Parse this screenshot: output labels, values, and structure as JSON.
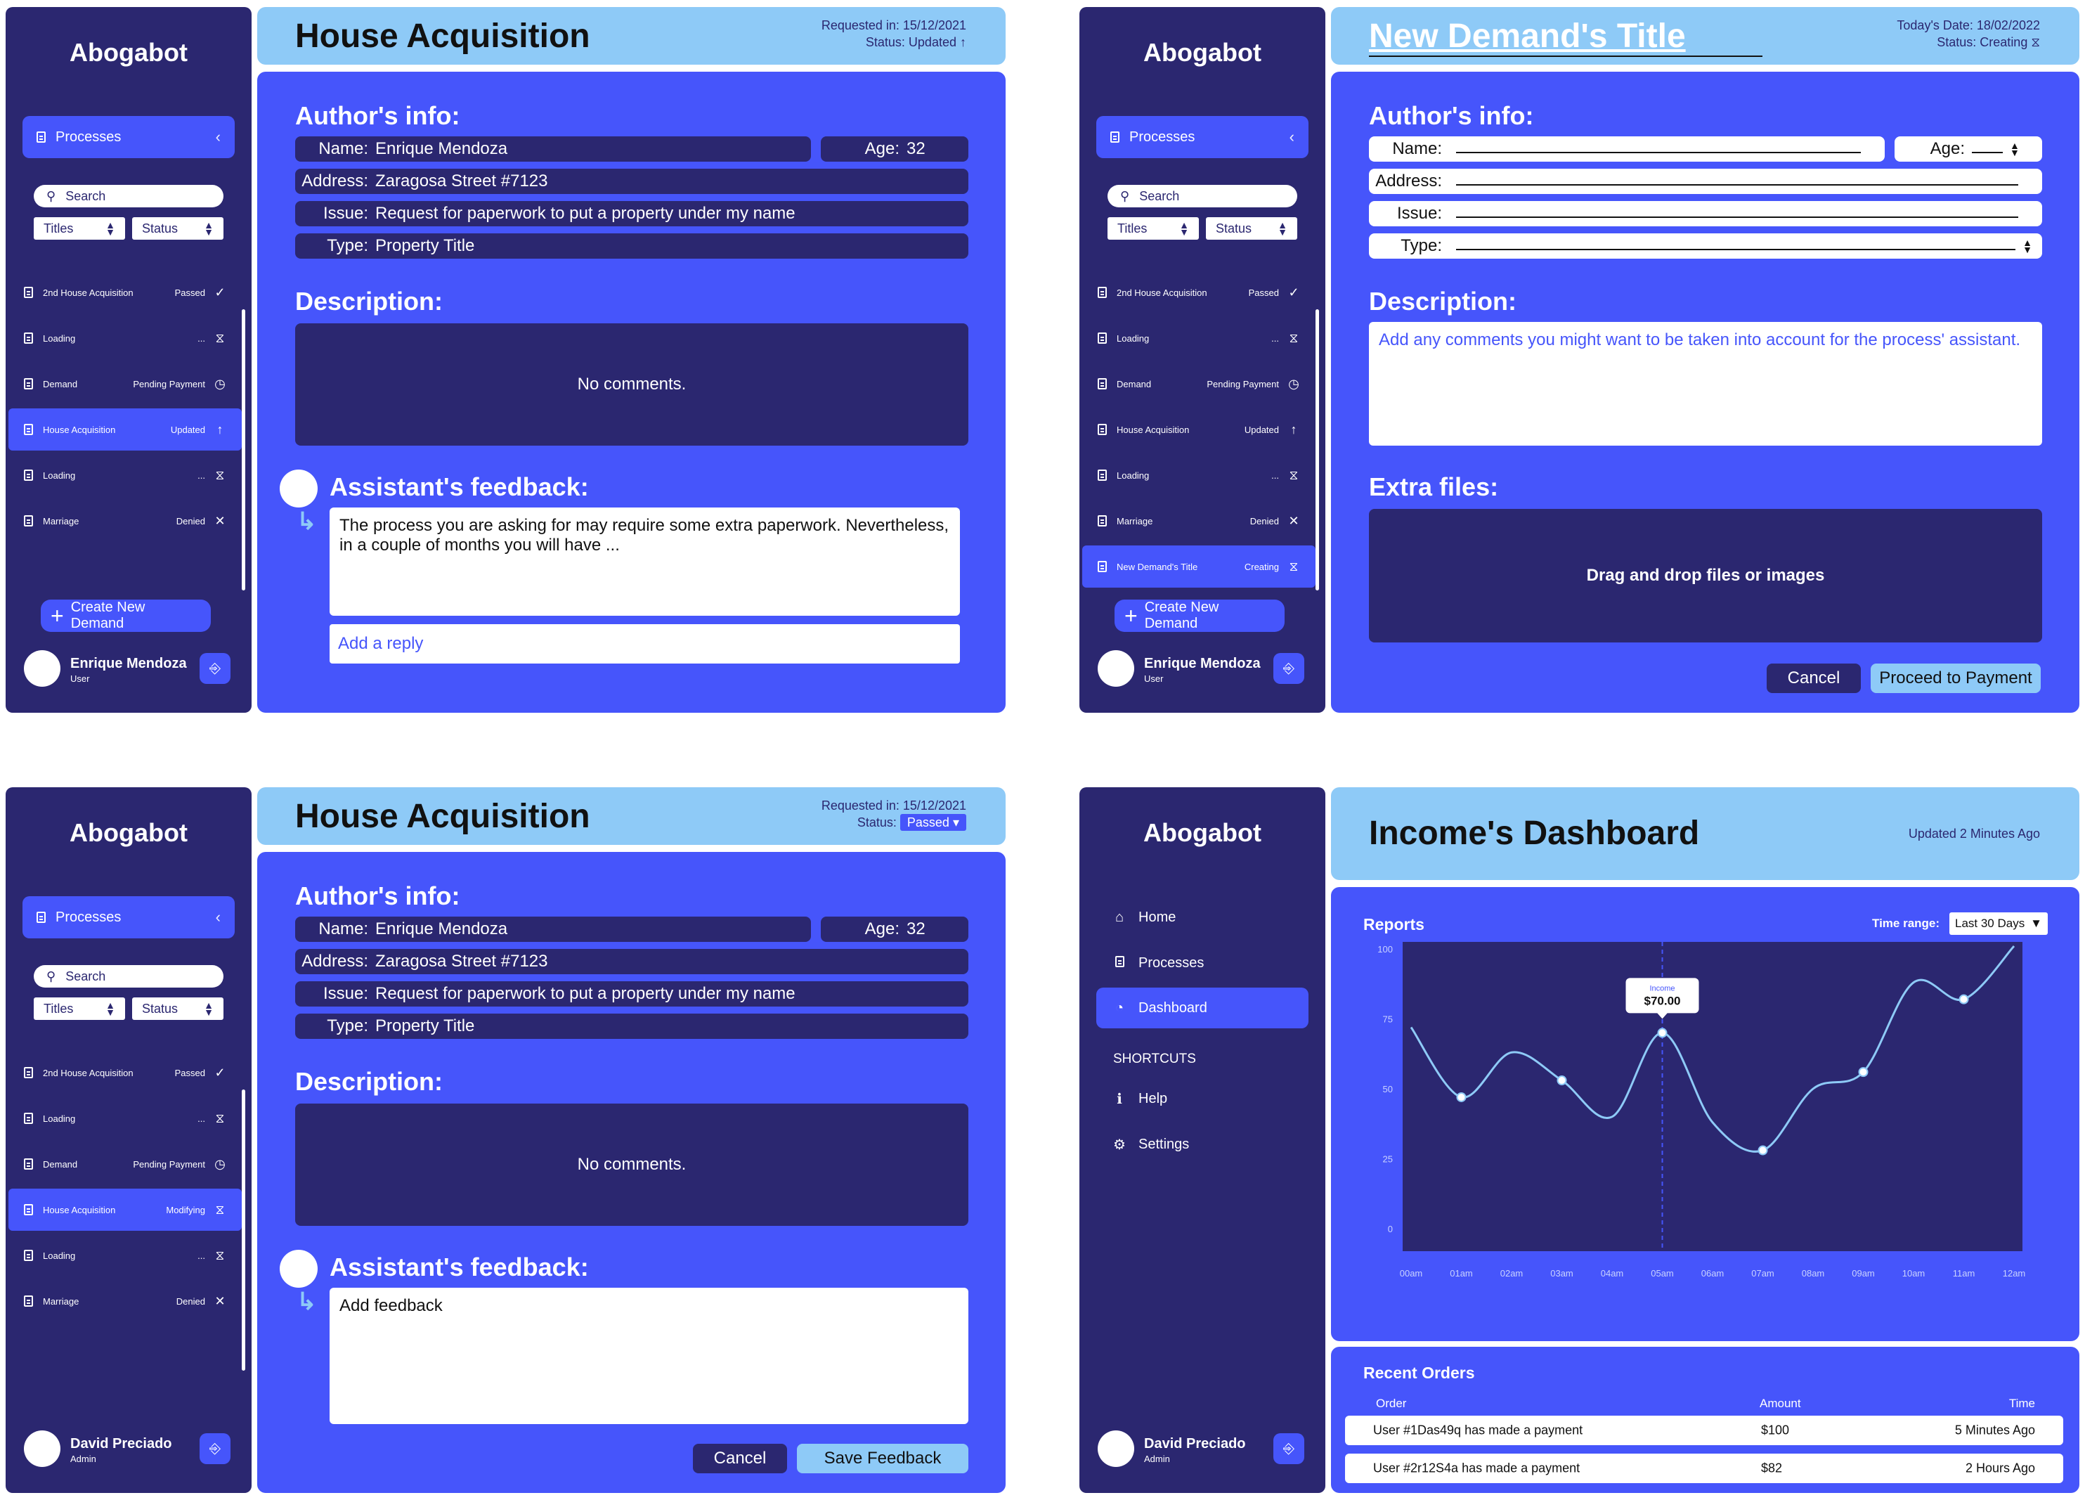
{
  "app_name": "Abogabot",
  "sidebar_common": {
    "processes_label": "Processes",
    "search_placeholder": "Search",
    "titles_filter": "Titles",
    "status_filter": "Status",
    "create_button": "Create New Demand"
  },
  "lists": {
    "p1": [
      {
        "name": "2nd House Acquisition",
        "status": "Passed",
        "icon": "check-icon"
      },
      {
        "name": "Loading",
        "status": "...",
        "icon": "hourglass-icon"
      },
      {
        "name": "Demand",
        "status": "Pending Payment",
        "icon": "clock-icon"
      },
      {
        "name": "House Acquisition",
        "status": "Updated",
        "icon": "arrow-up-icon",
        "active": true
      },
      {
        "name": "Loading",
        "status": "...",
        "icon": "hourglass-icon"
      },
      {
        "name": "Marriage",
        "status": "Denied",
        "icon": "x-icon"
      }
    ],
    "p2": [
      {
        "name": "2nd House Acquisition",
        "status": "Passed",
        "icon": "check-icon"
      },
      {
        "name": "Loading",
        "status": "...",
        "icon": "hourglass-icon"
      },
      {
        "name": "Demand",
        "status": "Pending Payment",
        "icon": "clock-icon"
      },
      {
        "name": "House Acquisition",
        "status": "Updated",
        "icon": "arrow-up-icon"
      },
      {
        "name": "Loading",
        "status": "...",
        "icon": "hourglass-icon"
      },
      {
        "name": "Marriage",
        "status": "Denied",
        "icon": "x-icon"
      },
      {
        "name": "New Demand's Title",
        "status": "Creating",
        "icon": "hourglass-icon",
        "active": true
      }
    ],
    "p3": [
      {
        "name": "2nd House Acquisition",
        "status": "Passed",
        "icon": "check-icon"
      },
      {
        "name": "Loading",
        "status": "...",
        "icon": "hourglass-icon"
      },
      {
        "name": "Demand",
        "status": "Pending Payment",
        "icon": "clock-icon"
      },
      {
        "name": "House Acquisition",
        "status": "Modifying",
        "icon": "hourglass-icon",
        "active": true
      },
      {
        "name": "Loading",
        "status": "...",
        "icon": "hourglass-icon"
      },
      {
        "name": "Marriage",
        "status": "Denied",
        "icon": "x-icon"
      }
    ]
  },
  "users": {
    "enrique": {
      "name": "Enrique Mendoza",
      "role": "User"
    },
    "david": {
      "name": "David Preciado",
      "role": "Admin"
    }
  },
  "p1": {
    "title": "House Acquisition",
    "requested": "Requested in: 15/12/2021",
    "status": "Status: Updated",
    "authors_info": "Author's info:",
    "name_label": "Name:",
    "name": "Enrique Mendoza",
    "age_label": "Age:",
    "age": "32",
    "address_label": "Address:",
    "address": "Zaragosa Street #7123",
    "issue_label": "Issue:",
    "issue": "Request for paperwork to put a property under my name",
    "type_label": "Type:",
    "type": "Property Title",
    "description": "Description:",
    "no_comments": "No comments.",
    "feedback_title": "Assistant's feedback:",
    "feedback_text": "The process you are asking for may require some extra paperwork. Nevertheless, in a couple of months you will have ...",
    "reply_placeholder": "Add a reply"
  },
  "p2": {
    "title": "New Demand's Title",
    "date": "Today's Date: 18/02/2022",
    "status": "Status: Creating",
    "authors_info": "Author's info:",
    "name_label": "Name:",
    "age_label": "Age:",
    "address_label": "Address:",
    "issue_label": "Issue:",
    "type_label": "Type:",
    "description": "Description:",
    "desc_placeholder": "Add any comments you might want to be taken into account for the process' assistant.",
    "extra_files": "Extra files:",
    "drop_text": "Drag and drop files or images",
    "cancel": "Cancel",
    "proceed": "Proceed to Payment"
  },
  "p3": {
    "title": "House Acquisition",
    "requested": "Requested in: 15/12/2021",
    "status_label": "Status:",
    "status_value": "Passed",
    "authors_info": "Author's info:",
    "name_label": "Name:",
    "name": "Enrique Mendoza",
    "age_label": "Age:",
    "age": "32",
    "address_label": "Address:",
    "address": "Zaragosa Street #7123",
    "issue_label": "Issue:",
    "issue": "Request for paperwork to put a property under my name",
    "type_label": "Type:",
    "type": "Property Title",
    "description": "Description:",
    "no_comments": "No comments.",
    "feedback_title": "Assistant's feedback:",
    "feedback_placeholder": "Add feedback",
    "cancel": "Cancel",
    "save": "Save Feedback"
  },
  "p4": {
    "nav": {
      "home": "Home",
      "processes": "Processes",
      "dashboard": "Dashboard",
      "shortcuts": "SHORTCUTS",
      "help": "Help",
      "settings": "Settings"
    },
    "title": "Income's Dashboard",
    "updated": "Updated 2 Minutes Ago",
    "reports": "Reports",
    "time_range_label": "Time range:",
    "time_range_value": "Last 30 Days",
    "tooltip_label": "Income",
    "tooltip_value": "$70.00",
    "recent_orders": "Recent Orders",
    "col_order": "Order",
    "col_amount": "Amount",
    "col_time": "Time",
    "orders": [
      {
        "order": "User #1Das49q has made a payment",
        "amount": "$100",
        "time": "5 Minutes Ago"
      },
      {
        "order": "User #2r12S4a has made a payment",
        "amount": "$82",
        "time": "2 Hours Ago"
      }
    ]
  },
  "chart_data": {
    "type": "line",
    "title": "",
    "xlabel": "",
    "ylabel": "",
    "x": [
      "00am",
      "01am",
      "02am",
      "03am",
      "04am",
      "05am",
      "06am",
      "07am",
      "08am",
      "09am",
      "10am",
      "11am",
      "12am"
    ],
    "y_ticks": [
      0,
      25,
      50,
      75,
      100
    ],
    "ylim": [
      0,
      100
    ],
    "values": [
      72,
      47,
      63,
      53,
      40,
      70,
      38,
      28,
      50,
      56,
      88,
      82,
      101
    ],
    "highlight_points": [
      1,
      3,
      5,
      7,
      9,
      11
    ],
    "tooltip_index": 5,
    "colors": {
      "line": "#8ecaf7",
      "plot_bg": "#2b2770"
    }
  },
  "colors": {
    "dark": "#2b2770",
    "accent": "#4655fb",
    "light": "#8ecaf7"
  }
}
